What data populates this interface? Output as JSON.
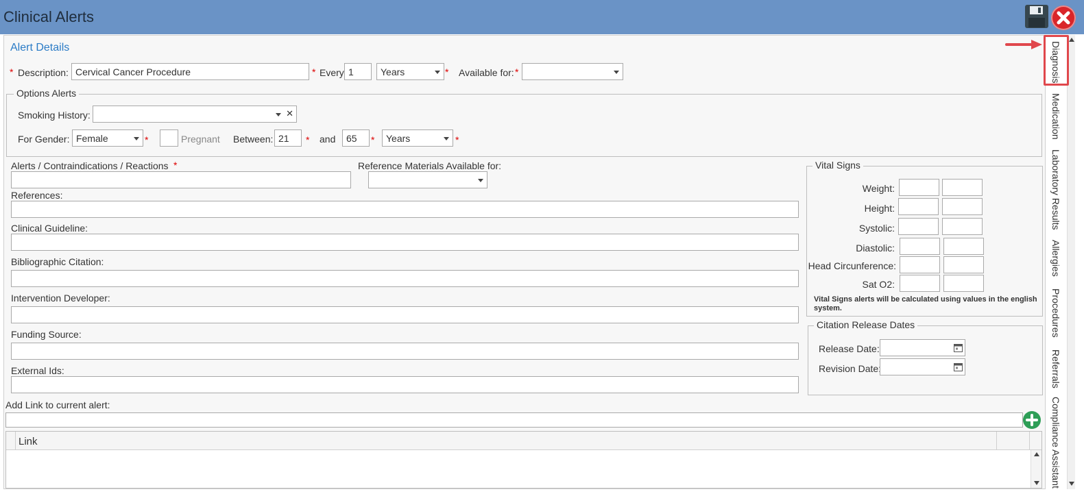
{
  "window": {
    "title": "Clinical Alerts"
  },
  "toolbar": {
    "save_icon": "floppy-disk-icon",
    "close_icon": "close-x-icon"
  },
  "alert_details": {
    "section_title": "Alert Details",
    "required_mark": "*",
    "description_label": "Description:",
    "description_value": "Cervical Cancer Procedure",
    "every_label": "Every:",
    "every_value": "1",
    "every_unit": "Years",
    "available_for_label": "Available for:",
    "available_for_value": ""
  },
  "options_alerts": {
    "legend": "Options Alerts",
    "smoking_history_label": "Smoking History:",
    "smoking_history_value": "",
    "clear_glyph": "✕",
    "for_gender_label": "For Gender:",
    "gender_value": "Female",
    "pregnant_label": "Pregnant",
    "pregnant_checked": false,
    "between_label": "Between:",
    "age_from": "21",
    "and_label": "and",
    "age_to": "65",
    "age_unit": "Years"
  },
  "fields": {
    "alerts_label": "Alerts / Contraindications / Reactions",
    "reference_materials_label": "Reference Materials Available for:",
    "references_label": "References:",
    "clinical_guideline_label": "Clinical Guideline:",
    "bibliographic_citation_label": "Bibliographic Citation:",
    "intervention_developer_label": "Intervention Developer:",
    "funding_source_label": "Funding Source:",
    "external_ids_label": "External Ids:",
    "add_link_label": "Add Link to current alert:"
  },
  "vital_signs": {
    "legend": "Vital Signs",
    "rows": [
      {
        "label": "Weight:"
      },
      {
        "label": "Height:"
      },
      {
        "label": "Systolic:"
      },
      {
        "label": "Diastolic:"
      },
      {
        "label": "Head Circunference:"
      },
      {
        "label": "Sat O2:"
      }
    ],
    "note": "Vital Signs alerts will be calculated using values in the english system."
  },
  "citation_release": {
    "legend": "Citation Release Dates",
    "release_date_label": "Release Date:",
    "revision_date_label": "Revision Date:"
  },
  "links_grid": {
    "column_header": "Link"
  },
  "side_tabs": [
    "Diagnosis",
    "Medication",
    "Laboratory Results",
    "Allergies",
    "Procedures",
    "Referrals",
    "Compliance Assistant"
  ],
  "colors": {
    "titlebar": "#6a93c6",
    "accent_blue": "#2a7bc6",
    "required_red": "#dd0000",
    "highlight": "#e0474c",
    "add_green": "#2e9e57"
  }
}
